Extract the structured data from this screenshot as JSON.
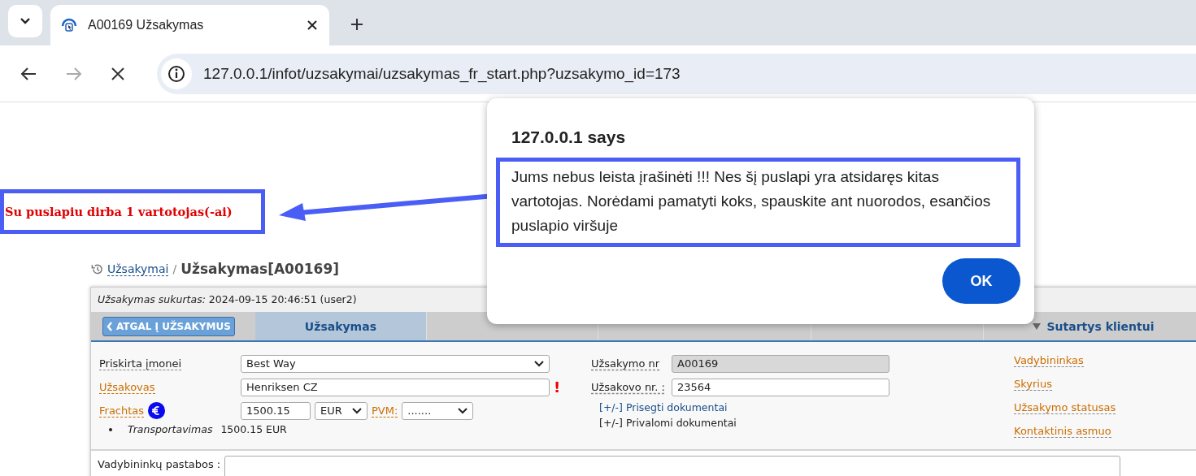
{
  "browser": {
    "tab_title": "A00169 Užsakymas",
    "url": "127.0.0.1/infot/uzsakymai/uzsakymas_fr_start.php?uzsakymo_id=173"
  },
  "warning": "Su puslapiu dirba 1 vartotojas(-ai)",
  "breadcrumb": {
    "link": "Užsakymai",
    "separator": "/",
    "current": "Užsakymas[A00169]"
  },
  "created": {
    "label": "Užsakymas sukurtas:",
    "value": "2024-09-15 20:46:51 (user2)"
  },
  "back_button": "ATGAL Į UŽSAKYMUS",
  "tabs": [
    {
      "label": "Užsakymas",
      "selected": true,
      "kind": "tab"
    },
    {
      "selected": false,
      "kind": "tab"
    },
    {
      "selected": false,
      "kind": "tab"
    },
    {
      "selected": false,
      "kind": "tab"
    },
    {
      "label": "Sutartys klientui",
      "selected": false,
      "kind": "menu"
    }
  ],
  "left_fields": [
    {
      "label": "Priskirta įmonei",
      "link": false,
      "kind": "select",
      "value": "Best Way"
    },
    {
      "label": "Užsakovas",
      "link": true,
      "kind": "text",
      "value": "Henriksen CZ",
      "required_mark": "!"
    },
    {
      "label": "Frachtas",
      "link": true,
      "kind": "freight",
      "amount": "1500.15",
      "currency": "EUR",
      "vat_label": "PVM:",
      "vat": "......."
    }
  ],
  "charges": [
    {
      "name": "Transportavimas",
      "amount": "1500.15 EUR"
    }
  ],
  "middle_fields": [
    {
      "label": "Užsakymo nr",
      "value": "A00169",
      "readonly": true
    },
    {
      "label": "Užsakovo nr. :",
      "value": "23564",
      "readonly": false
    }
  ],
  "documents": [
    {
      "toggle": "[+/-]",
      "label": "Prisegti dokumentai",
      "link": true
    },
    {
      "toggle": "[+/-]",
      "label": "Privalomi dokumentai",
      "link": false
    }
  ],
  "right_links": [
    "Vadybininkas",
    "Skyrius",
    "Užsakymo statusas",
    "Kontaktinis asmuo"
  ],
  "notes": {
    "label": "Vadybininkų pastabos :"
  },
  "dialog": {
    "title": "127.0.0.1 says",
    "message": "Jums nebus leista įrašinėti !!! Nes šį puslapi yra atsidaręs kitas vartotojas. Norėdami pamatyti koks, spauskite ant nuorodos, esančios puslapio viršuje",
    "button": "OK"
  }
}
